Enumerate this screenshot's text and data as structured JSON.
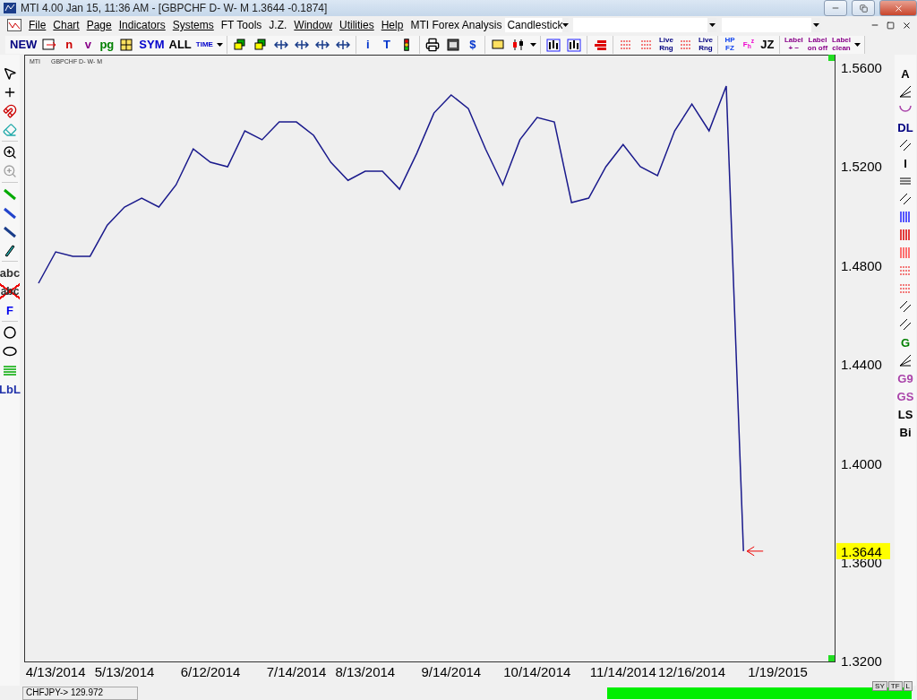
{
  "window": {
    "title": "MTI 4.00 Jan 15,  11:36 AM - [GBPCHF D- W- M  1.3644   -0.1874]"
  },
  "menu": {
    "items": [
      {
        "label": "File",
        "underlined": true
      },
      {
        "label": "Chart",
        "underlined": true
      },
      {
        "label": "Page",
        "underlined": true
      },
      {
        "label": "Indicators",
        "underlined": true
      },
      {
        "label": "Systems",
        "underlined": true
      },
      {
        "label": "FT Tools",
        "underlined": false
      },
      {
        "label": "J.Z.",
        "underlined": false
      },
      {
        "label": "Window",
        "underlined": true
      },
      {
        "label": "Utilities",
        "underlined": true
      },
      {
        "label": "Help",
        "underlined": true
      },
      {
        "label": "MTI Forex Analysis",
        "underlined": false
      }
    ],
    "chart_type": "Candlestick"
  },
  "toolbar": [
    {
      "items": [
        {
          "kind": "text",
          "label": "NEW",
          "color": "#000080"
        },
        {
          "kind": "icon"
        },
        {
          "kind": "text",
          "label": "n",
          "color": "#cc0000"
        },
        {
          "kind": "text",
          "label": "v",
          "color": "#880088"
        },
        {
          "kind": "text",
          "label": "pg",
          "color": "#008000"
        },
        {
          "kind": "icon"
        },
        {
          "kind": "text",
          "label": "SYM",
          "color": "#0000cc"
        },
        {
          "kind": "text",
          "label": "ALL",
          "color": "#000000"
        },
        {
          "kind": "text",
          "label": "TIME",
          "color": "#0000cc"
        },
        {
          "kind": "caret"
        }
      ]
    },
    {
      "items": [
        {
          "kind": "icon"
        },
        {
          "kind": "icon"
        },
        {
          "kind": "icon"
        },
        {
          "kind": "icon"
        },
        {
          "kind": "icon"
        },
        {
          "kind": "icon"
        }
      ]
    },
    {
      "items": [
        {
          "kind": "text",
          "label": "i",
          "color": "#0033cc"
        },
        {
          "kind": "text",
          "label": "T",
          "color": "#0033cc"
        },
        {
          "kind": "icon"
        }
      ]
    },
    {
      "items": [
        {
          "kind": "icon"
        },
        {
          "kind": "icon"
        },
        {
          "kind": "text",
          "label": "$",
          "color": "#0033cc"
        }
      ]
    },
    {
      "items": [
        {
          "kind": "icon"
        },
        {
          "kind": "icon"
        },
        {
          "kind": "caret"
        }
      ]
    },
    {
      "items": [
        {
          "kind": "icon"
        },
        {
          "kind": "icon"
        }
      ]
    },
    {
      "items": [
        {
          "kind": "icon"
        }
      ]
    },
    {
      "items": [
        {
          "kind": "icon"
        },
        {
          "kind": "icon"
        },
        {
          "kind": "stacked",
          "label": "Live",
          "sublabel": "Rng",
          "color": "#000080"
        },
        {
          "kind": "icon"
        },
        {
          "kind": "stacked",
          "label": "Live",
          "sublabel": "Rng",
          "color": "#000080"
        }
      ]
    },
    {
      "items": [
        {
          "kind": "stacked",
          "label": "HP",
          "sublabel": "FZ",
          "color": "#1144ee"
        },
        {
          "kind": "text",
          "label": "F$_{h}$$^{z}$",
          "color": "#ee00cc"
        },
        {
          "kind": "text",
          "label": "JZ",
          "color": "#000000"
        }
      ]
    },
    {
      "items": [
        {
          "kind": "stacked",
          "label": "Label",
          "sublabel": "+ −",
          "color": "#880088"
        },
        {
          "kind": "stacked",
          "label": "Label",
          "sublabel": "on off",
          "color": "#880088"
        },
        {
          "kind": "stacked",
          "label": "Label",
          "sublabel": "clean",
          "color": "#880088"
        },
        {
          "kind": "caret"
        }
      ]
    }
  ],
  "left_tools": [
    {
      "kind": "icon"
    },
    {
      "kind": "icon"
    },
    {
      "kind": "icon"
    },
    {
      "kind": "icon"
    },
    {
      "kind": "sep"
    },
    {
      "kind": "icon"
    },
    {
      "kind": "icon",
      "disabled": true
    },
    {
      "kind": "sep"
    },
    {
      "kind": "icon"
    },
    {
      "kind": "icon"
    },
    {
      "kind": "icon"
    },
    {
      "kind": "icon"
    },
    {
      "kind": "sep"
    },
    {
      "kind": "text",
      "label": "abc",
      "color": "#333333"
    },
    {
      "kind": "struck",
      "label": "abc",
      "color": "#333333"
    },
    {
      "kind": "text",
      "label": "F",
      "color": "#0000ee"
    },
    {
      "kind": "sep"
    },
    {
      "kind": "icon"
    },
    {
      "kind": "icon"
    },
    {
      "kind": "icon"
    },
    {
      "kind": "text",
      "label": "LbL",
      "color": "#2233aa"
    }
  ],
  "right_tools": [
    {
      "kind": "text",
      "label": "A",
      "color": "#000000"
    },
    {
      "kind": "icon"
    },
    {
      "kind": "icon"
    },
    {
      "kind": "text",
      "label": "DL",
      "color": "#000080"
    },
    {
      "kind": "icon"
    },
    {
      "kind": "text",
      "label": "I",
      "color": "#000000"
    },
    {
      "kind": "icon"
    },
    {
      "kind": "icon"
    },
    {
      "kind": "icon"
    },
    {
      "kind": "icon"
    },
    {
      "kind": "icon"
    },
    {
      "kind": "icon"
    },
    {
      "kind": "icon"
    },
    {
      "kind": "icon"
    },
    {
      "kind": "icon"
    },
    {
      "kind": "text",
      "label": "G",
      "color": "#008000"
    },
    {
      "kind": "icon"
    },
    {
      "kind": "text",
      "label": "G9",
      "color": "#aa44aa"
    },
    {
      "kind": "text",
      "label": "GS",
      "color": "#aa44aa"
    },
    {
      "kind": "text",
      "label": "LS",
      "color": "#000000"
    },
    {
      "kind": "text",
      "label": "Bi",
      "color": "#000000"
    }
  ],
  "chart": {
    "source": "MTI",
    "symbol": "GBPCHF D- W- M",
    "last_price": "1.3644",
    "chart_data": {
      "type": "line",
      "ylim": [
        1.3198,
        1.5651
      ],
      "categories": [
        null,
        "4/13/2014",
        null,
        null,
        null,
        "5/13/2014",
        null,
        null,
        null,
        null,
        "6/12/2014",
        null,
        null,
        null,
        null,
        "7/14/2014",
        null,
        null,
        null,
        "8/13/2014",
        null,
        null,
        null,
        null,
        "9/14/2014",
        null,
        null,
        null,
        null,
        "10/14/2014",
        null,
        null,
        null,
        null,
        "11/14/2014",
        null,
        null,
        null,
        "12/16/2014",
        null,
        null,
        null,
        null,
        "1/19/2015"
      ],
      "series": [
        {
          "color": "#1a1a8c",
          "values": [
            1.4727,
            1.4854,
            1.4836,
            1.4836,
            1.4962,
            1.5035,
            1.5071,
            1.5035,
            1.5125,
            1.527,
            1.5216,
            1.5198,
            1.5343,
            1.5307,
            1.5379,
            1.5379,
            1.5325,
            1.5216,
            1.5143,
            1.518,
            1.518,
            1.5107,
            1.5252,
            1.5415,
            1.5488,
            1.5433,
            1.527,
            1.5125,
            1.5307,
            1.5397,
            1.5379,
            1.5053,
            1.5071,
            1.5198,
            1.5288,
            1.5198,
            1.5162,
            1.5343,
            1.5451,
            1.5343,
            1.5524,
            1.3644,
            null,
            null
          ]
        }
      ],
      "yticks": [
        {
          "value": 1.56,
          "label": "1.5600"
        },
        {
          "value": 1.52,
          "label": "1.5200"
        },
        {
          "value": 1.48,
          "label": "1.4800"
        },
        {
          "value": 1.44,
          "label": "1.4400"
        },
        {
          "value": 1.4,
          "label": "1.4000"
        },
        {
          "value": 1.36,
          "label": "1.3600"
        },
        {
          "value": 1.32,
          "label": "1.3200"
        }
      ]
    }
  },
  "chart_buttons": [
    "SY",
    "TF",
    "L"
  ],
  "status_bar": {
    "quote": "CHFJPY->  129.972",
    "level": 1
  }
}
